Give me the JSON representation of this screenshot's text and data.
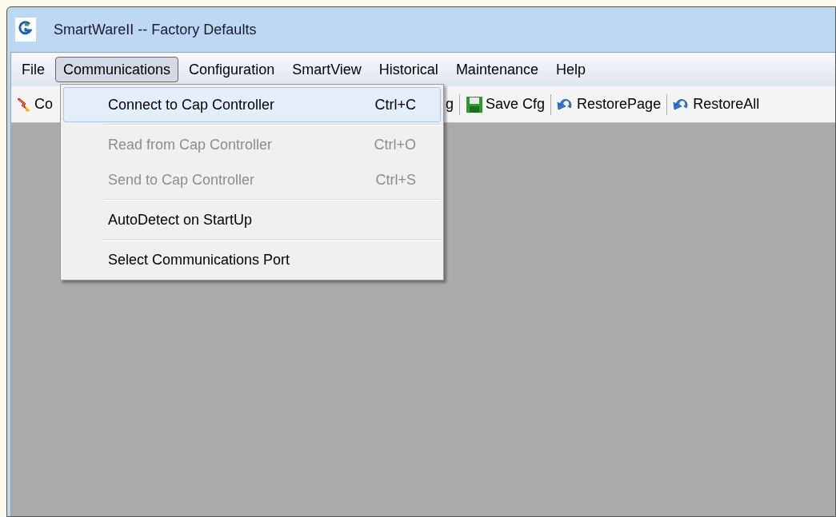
{
  "window": {
    "title": "SmartWareII  --  Factory Defaults"
  },
  "menubar": [
    {
      "label": "File",
      "selected": false
    },
    {
      "label": "Communications",
      "selected": true
    },
    {
      "label": "Configuration",
      "selected": false
    },
    {
      "label": "SmartView",
      "selected": false
    },
    {
      "label": "Historical",
      "selected": false
    },
    {
      "label": "Maintenance",
      "selected": false
    },
    {
      "label": "Help",
      "selected": false
    }
  ],
  "toolbar": [
    {
      "label": "Co",
      "kind": "connect"
    },
    {
      "label": "g",
      "kind": "partial"
    },
    {
      "label": "Save Cfg",
      "kind": "save"
    },
    {
      "label": "RestorePage",
      "kind": "restore"
    },
    {
      "label": "RestoreAll",
      "kind": "restore"
    }
  ],
  "menu": {
    "groups": [
      [
        {
          "label": "Connect to Cap Controller",
          "shortcut": "Ctrl+C",
          "disabled": false,
          "selected": true
        }
      ],
      [
        {
          "label": "Read from Cap Controller",
          "shortcut": "Ctrl+O",
          "disabled": true,
          "selected": false
        },
        {
          "label": "Send to Cap Controller",
          "shortcut": "Ctrl+S",
          "disabled": true,
          "selected": false
        }
      ],
      [
        {
          "label": "AutoDetect on StartUp",
          "disabled": false,
          "selected": false
        }
      ],
      [
        {
          "label": "Select Communications Port",
          "disabled": false,
          "selected": false
        }
      ]
    ]
  }
}
